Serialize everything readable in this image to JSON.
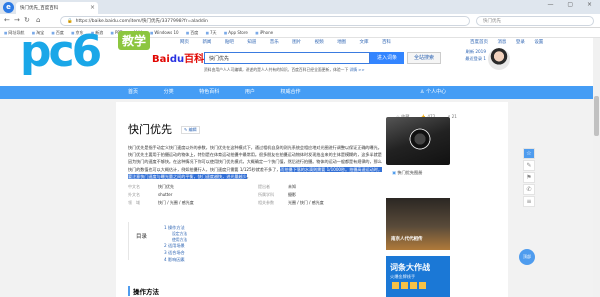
{
  "browser": {
    "tab_title": "快门优先_百度百科",
    "url": "https://baike.baidu.com/item/快门优先/3377998?fr=aladdin",
    "search_engine_placeholder": "快门优先",
    "bookmarks": [
      "网址导航",
      "淘宝",
      "百度",
      "京东",
      "新浪",
      "PPT",
      "M4A",
      "Windows 10",
      "百度",
      "7天",
      "App Store",
      "iPhone"
    ]
  },
  "top_links": [
    "网页",
    "新闻",
    "贴吧",
    "知道",
    "音乐",
    "图片",
    "视频",
    "地图",
    "文库",
    "百科"
  ],
  "top_right": [
    "百度首页",
    "消息",
    "登录",
    "设置"
  ],
  "watermark": {
    "word": "pc6",
    "badge": "教学"
  },
  "search": {
    "query": "快门优先",
    "enter_label": "进入词条",
    "full_search_label": "全站搜索",
    "notice": "资料由用户人人可编辑，讲述的是人人共有的知识。百度百科已经全面更新，体验一下",
    "notice_more": "详情 >>"
  },
  "user": {
    "name": "刷新 2019",
    "level": "最近登录 1"
  },
  "nav": {
    "items": [
      "首页",
      "分类",
      "特色百科",
      "用户",
      "权威合作"
    ],
    "right": "个人中心"
  },
  "actions": [
    "收藏",
    "472",
    "21"
  ],
  "article": {
    "title": "快门优先",
    "edit_label": "编辑",
    "summary_before": "快门优先是指手动定义快门速度以外的参数，快门优先在这种模式下，通过相机自身的测光系统会相应地对光圈进行调整以保证正确的曝光。快门优先主要用于拍摄运动的物体上，特别是在体育运动拍摄中最常用。很多朋友在拍摄运动物体时发现拍出来的主体是模糊的，这多半就是因为快门的速度不够快。在这种情况下你可以使用快门优先模式，大概确定一个快门值，然后进行拍摄。物体的运动一般都是有规律的，那么快门的数值也可以大概估计，例如拍摄行人，快门速度只需要 1/125秒就差不多了，",
    "summary_highlight": "而拍摄下落的水滴则需要 1/1000秒。拍摄高速运动时，要注意快门速度与曝光量之间的平衡，快门速度越快，进光量越少",
    "summary_after": "。"
  },
  "info_rows": [
    [
      "中文名",
      "快门优先",
      "提出者",
      "未知"
    ],
    [
      "外文名",
      "shutter",
      "所属学科",
      "摄影"
    ],
    [
      "领　域",
      "快门 / 光圈 / 感光度",
      "相关参数",
      "光圈 / 快门 / 感光度"
    ]
  ],
  "toc": {
    "label": "目录",
    "items": [
      "1 操作方法",
      "设定方法",
      "使用方法",
      "2 适用场景",
      "3 适合场合",
      "4 影响因素"
    ]
  },
  "section_title": "操作方法",
  "right_panel": {
    "camera_caption": "快门优先图册",
    "ad1_text": "南京人代代相传",
    "ad2_title": "词条大作战",
    "ad2_sub": "火爆金牌线手"
  },
  "float_buttons": [
    "☆",
    "✎",
    "⚑",
    "✆",
    "≡"
  ],
  "float_circle": "顶部"
}
